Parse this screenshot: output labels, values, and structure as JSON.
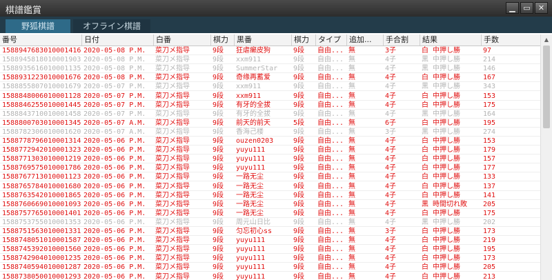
{
  "window": {
    "title": "棋譜鑑賞"
  },
  "tabs": [
    {
      "label": "野狐棋譜"
    },
    {
      "label": "オフライン棋譜"
    }
  ],
  "columns": [
    "番号",
    "日付",
    "白番",
    "棋力",
    "黒番",
    "棋力",
    "タイプ",
    "追加...",
    "手合割",
    "結果",
    "手数"
  ],
  "rows": [
    [
      "1588947683010001416",
      "2020-05-08 P.M.",
      "菜刀メ指导",
      "9段",
      "狂虐癞皮狗",
      "9段",
      "自由...",
      "無",
      "3子",
      "白 中押し勝",
      "97",
      "red"
    ],
    [
      "1588945818010001903",
      "2020-05-08 P.M.",
      "菜刀メ指导",
      "9段",
      "xxm911",
      "9段",
      "自由...",
      "無",
      "4子",
      "黒 中押し勝",
      "214",
      "gray"
    ],
    [
      "1588935616010001135",
      "2020-05-08 P.M.",
      "菜刀メ指导",
      "9段",
      "SummerStar",
      "9段",
      "自由...",
      "無",
      "4子",
      "黒 中押し勝",
      "146",
      "gray"
    ],
    [
      "1588931223010001676",
      "2020-05-08 P.M.",
      "菜刀メ指导",
      "9段",
      "奇缘再蓄爱",
      "9段",
      "自由...",
      "無",
      "4子",
      "白 中押し勝",
      "167",
      "red"
    ],
    [
      "1588855807010001679",
      "2020-05-07 P.M.",
      "菜刀メ指导",
      "9段",
      "xxm911",
      "9段",
      "自由...",
      "無",
      "4子",
      "黒 中押し勝",
      "343",
      "gray"
    ],
    [
      "1588848006010001128",
      "2020-05-07 P.M.",
      "菜刀メ指导",
      "9段",
      "xxm911",
      "9段",
      "自由...",
      "無",
      "4子",
      "白 中押し勝",
      "153",
      "red"
    ],
    [
      "1588846255010001445",
      "2020-05-07 P.M.",
      "菜刀メ指导",
      "9段",
      "有牙的全拔",
      "9段",
      "自由...",
      "無",
      "4子",
      "白 中押し勝",
      "175",
      "red"
    ],
    [
      "1588843710010001458",
      "2020-05-07 P.M.",
      "菜刀メ指导",
      "9段",
      "有牙的全拔",
      "9段",
      "自由...",
      "無",
      "4子",
      "黒 中押し勝",
      "164",
      "gray"
    ],
    [
      "1588800703010001345",
      "2020-05-07 A.M.",
      "菜刀メ指导",
      "9段",
      "前天的前天",
      "5段",
      "自由...",
      "無",
      "6子",
      "白 中押し勝",
      "195",
      "red"
    ],
    [
      "1588782306010001620",
      "2020-05-07 A.M.",
      "菜刀メ指导",
      "9段",
      "香海己楼",
      "9段",
      "自由...",
      "無",
      "3子",
      "黒 中押し勝",
      "274",
      "gray"
    ],
    [
      "1588778796010001314",
      "2020-05-06 P.M.",
      "菜刀メ指导",
      "9段",
      "ouzen0203",
      "9段",
      "自由...",
      "無",
      "4子",
      "白 中押し勝",
      "153",
      "red"
    ],
    [
      "1588772942010001323",
      "2020-05-06 P.M.",
      "菜刀メ指导",
      "9段",
      "yuyu111",
      "9段",
      "自由...",
      "無",
      "4子",
      "白 中押し勝",
      "179",
      "red"
    ],
    [
      "1588771303010001219",
      "2020-05-06 P.M.",
      "菜刀メ指导",
      "9段",
      "yuyu111",
      "9段",
      "自由...",
      "無",
      "4子",
      "白 中押し勝",
      "157",
      "red"
    ],
    [
      "1588769575010001786",
      "2020-05-06 P.M.",
      "菜刀メ指导",
      "9段",
      "yuyu111",
      "9段",
      "自由...",
      "無",
      "4子",
      "白 中押し勝",
      "177",
      "red"
    ],
    [
      "1588767713010001123",
      "2020-05-06 P.M.",
      "菜刀メ指导",
      "9段",
      "一路无尘",
      "9段",
      "自由...",
      "無",
      "4子",
      "白 中押し勝",
      "133",
      "red"
    ],
    [
      "1588765784010001680",
      "2020-05-06 P.M.",
      "菜刀メ指导",
      "9段",
      "一路无尘",
      "9段",
      "自由...",
      "無",
      "4子",
      "白 中押し勝",
      "137",
      "red"
    ],
    [
      "1588763542010001865",
      "2020-05-06 P.M.",
      "菜刀メ指导",
      "9段",
      "一路无尘",
      "9段",
      "自由...",
      "無",
      "4子",
      "白 中押し勝",
      "141",
      "red"
    ],
    [
      "1588760669010001093",
      "2020-05-06 P.M.",
      "菜刀メ指导",
      "9段",
      "一路无尘",
      "9段",
      "自由...",
      "無",
      "4子",
      "黒 時間切れ敗",
      "205",
      "red"
    ],
    [
      "1588757765010001401",
      "2020-05-06 P.M.",
      "菜刀メ指导",
      "9段",
      "一路无尘",
      "9段",
      "自由...",
      "無",
      "4子",
      "白 中押し勝",
      "175",
      "red"
    ],
    [
      "1588753755010001353",
      "2020-05-06 P.M.",
      "菜刀メ指导",
      "9段",
      "周元山日比",
      "9段",
      "自由...",
      "無",
      "4子",
      "黒 中押し勝",
      "202",
      "gray"
    ],
    [
      "1588751563010001331",
      "2020-05-06 P.M.",
      "菜刀メ指导",
      "9段",
      "匀忘初心ss",
      "9段",
      "自由...",
      "無",
      "3子",
      "白 中押し勝",
      "173",
      "red"
    ],
    [
      "1588748051010001587",
      "2020-05-06 P.M.",
      "菜刀メ指导",
      "9段",
      "yuyu111",
      "9段",
      "自由...",
      "無",
      "4子",
      "白 中押し勝",
      "219",
      "red"
    ],
    [
      "1588745392010001560",
      "2020-05-06 P.M.",
      "菜刀メ指导",
      "9段",
      "yuyu111",
      "9段",
      "自由...",
      "無",
      "4子",
      "白 中押し勝",
      "195",
      "red"
    ],
    [
      "1588742904010001235",
      "2020-05-06 P.M.",
      "菜刀メ指导",
      "9段",
      "yuyu111",
      "9段",
      "自由...",
      "無",
      "4子",
      "白 中押し勝",
      "173",
      "red"
    ],
    [
      "1588740594010001287",
      "2020-05-06 P.M.",
      "菜刀メ指导",
      "9段",
      "yuyu111",
      "9段",
      "自由...",
      "無",
      "4子",
      "白 中押し勝",
      "205",
      "red"
    ],
    [
      "1588738050010001293",
      "2020-05-06 P.M.",
      "菜刀メ指导",
      "9段",
      "yuyu111",
      "9段",
      "自由...",
      "無",
      "4子",
      "白 中押し勝",
      "213",
      "red"
    ]
  ]
}
